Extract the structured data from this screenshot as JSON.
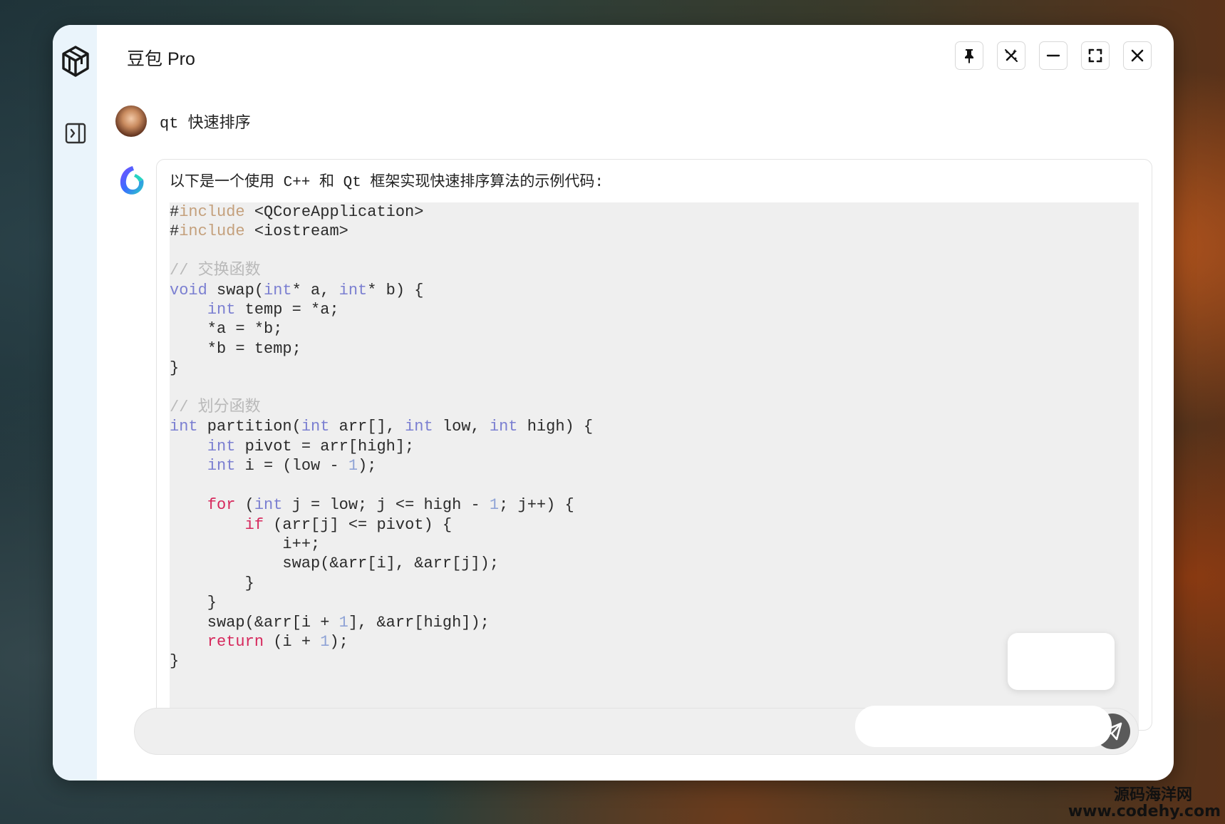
{
  "window": {
    "title": "豆包 Pro",
    "controls": [
      {
        "name": "pin-button",
        "icon": "pin-icon"
      },
      {
        "name": "clear-button",
        "icon": "magic-wand-off-icon"
      },
      {
        "name": "minimize-button",
        "icon": "minus-icon"
      },
      {
        "name": "fullscreen-button",
        "icon": "fullscreen-icon"
      },
      {
        "name": "close-button",
        "icon": "close-icon"
      }
    ]
  },
  "sidebar": {
    "logo_icon": "cube-icon",
    "toggle_icon": "panel-expand-icon"
  },
  "conversation": {
    "user_message": "qt 快速排序",
    "assistant_intro": "以下是一个使用 C++ 和 Qt 框架实现快速排序算法的示例代码:",
    "code_lines": [
      "#include <QCoreApplication>",
      "#include <iostream>",
      "",
      "// 交换函数",
      "void swap(int* a, int* b) {",
      "    int temp = *a;",
      "    *a = *b;",
      "    *b = temp;",
      "}",
      "",
      "// 划分函数",
      "int partition(int arr[], int low, int high) {",
      "    int pivot = arr[high];",
      "    int i = (low - 1);",
      "",
      "    for (int j = low; j <= high - 1; j++) {",
      "        if (arr[j] <= pivot) {",
      "            i++;",
      "            swap(&arr[i], &arr[j]);",
      "        }",
      "    }",
      "    swap(&arr[i + 1], &arr[high]);",
      "    return (i + 1);",
      "}"
    ]
  },
  "input": {
    "placeholder": "",
    "send_icon": "paper-plane-icon"
  },
  "watermark": {
    "line1": "源码海洋网",
    "line2": "www.codehy.com"
  },
  "colors": {
    "rail": "#eaf4fb",
    "keyword": "#7b7fd1",
    "control_keyword": "#d6285c",
    "include": "#c4a07c",
    "number": "#8fa3d6",
    "comment": "#b9b9b9",
    "code_bg": "#efefef"
  }
}
